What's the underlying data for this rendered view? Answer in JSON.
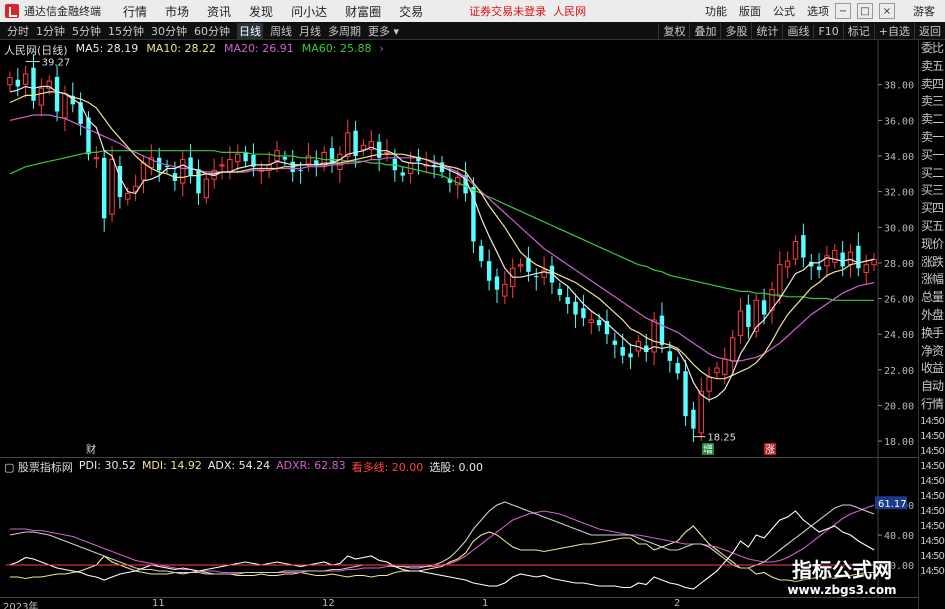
{
  "titlebar": {
    "app_name": "通达信金融终端",
    "menu": [
      "行情",
      "市场",
      "资讯",
      "发现",
      "问小达",
      "财富圈",
      "交易"
    ],
    "notice": "证券交易未登录",
    "stock_name": "人民网",
    "right_menu": [
      "功能",
      "版面",
      "公式",
      "选项"
    ],
    "guest": "游客",
    "window_controls": [
      "−",
      "□",
      "×"
    ]
  },
  "toolbar": {
    "periods": [
      "分时",
      "1分钟",
      "5分钟",
      "15分钟",
      "30分钟",
      "60分钟",
      "日线",
      "周线",
      "月线",
      "多周期",
      "更多"
    ],
    "active_period": "日线",
    "tools": [
      "复权",
      "叠加",
      "多股",
      "统计",
      "画线",
      "F10",
      "标记",
      "+自选",
      "返回"
    ]
  },
  "main_legend": {
    "title": "人民网(日线)",
    "ma5": "MA5: 28.19",
    "ma10": "MA10: 28.22",
    "ma20": "MA20: 26.91",
    "ma60": "MA60: 25.88"
  },
  "annotations": {
    "high": "39.27",
    "low": "18.25",
    "marker_cai": "财",
    "marker_lian": "涨",
    "marker_xian": "增"
  },
  "indicator_legend": {
    "name": "股票指标网",
    "pdi": "PDI: 30.52",
    "mdi": "MDI: 14.92",
    "adx": "ADX: 54.24",
    "adxr": "ADXR: 62.83",
    "fast": "看多线: 20.00",
    "select": "选股: 0.00",
    "current_value": "61.17"
  },
  "sidepanel": [
    "委比",
    "卖五",
    "卖四",
    "卖三",
    "卖二",
    "卖一",
    "买一",
    "买二",
    "买三",
    "买四",
    "买五",
    "现价",
    "涨跌",
    "涨幅",
    "总量",
    "外盘",
    "换手",
    "净资",
    "收益",
    "自动",
    "行情",
    "14:50",
    "14:50",
    "14:50",
    "14:50",
    "14:50",
    "14:50",
    "14:50",
    "14:50",
    "14:50",
    "14:50",
    "14:50"
  ],
  "time_axis": [
    "2023年",
    "11",
    "12",
    "1",
    "2"
  ],
  "watermark": {
    "title": "指标公式网",
    "url": "www.zbgs3.com"
  },
  "colors": {
    "up": "#ff3c3c",
    "down": "#54ffff",
    "ma5": "#e8e8e8",
    "ma10": "#f0e68c",
    "ma20": "#d060d0",
    "ma60": "#3cc83c"
  },
  "chart_data": {
    "type": "line",
    "ylim": [
      17.5,
      39.5
    ],
    "y_ticks": [
      "38.00",
      "36.00",
      "34.00",
      "32.00",
      "30.00",
      "28.00",
      "26.00",
      "24.00",
      "22.00",
      "20.00",
      "18.00"
    ],
    "close": [
      38.4,
      37.9,
      38.6,
      37.1,
      37.8,
      38.2,
      36.5,
      37.5,
      36.9,
      35.8,
      34.1,
      33.9,
      30.5,
      33.8,
      31.7,
      31.9,
      32.3,
      33.6,
      33.9,
      33.2,
      33.4,
      32.6,
      33.8,
      32.9,
      31.9,
      32.7,
      33.2,
      33.5,
      33.8,
      34.1,
      33.7,
      33.4,
      33.2,
      33.5,
      34.3,
      33.8,
      33.1,
      33.2,
      34.0,
      33.5,
      34.2,
      33.6,
      34.1,
      35.3,
      34.0,
      34.6,
      34.8,
      33.9,
      34.2,
      33.2,
      32.9,
      33.6,
      33.7,
      33.5,
      33.4,
      33.1,
      32.5,
      32.8,
      31.9,
      29.2,
      28.1,
      27.0,
      26.5,
      26.8,
      27.7,
      27.9,
      27.5,
      27.2,
      27.6,
      26.9,
      26.2,
      25.7,
      25.1,
      24.9,
      24.8,
      24.5,
      24.0,
      23.4,
      22.8,
      22.7,
      23.6,
      23.0,
      24.8,
      23.4,
      22.5,
      21.8,
      19.4,
      18.7,
      20.8,
      21.6,
      22.1,
      22.6,
      23.8,
      25.3,
      24.4,
      25.9,
      25.1,
      26.5,
      27.9,
      28.1,
      29.2,
      28.3,
      27.8,
      27.6,
      28.4,
      28.7,
      27.8,
      28.6,
      27.7,
      27.9,
      28.2
    ],
    "ma5": [
      37.6,
      37.7,
      37.9,
      37.8,
      37.9,
      37.9,
      37.6,
      37.5,
      37.2,
      36.9,
      36.0,
      35.6,
      34.3,
      34.0,
      32.8,
      32.0,
      31.9,
      32.6,
      32.7,
      32.9,
      33.3,
      33.3,
      33.5,
      33.3,
      33.2,
      33.0,
      32.9,
      33.1,
      33.1,
      33.3,
      33.4,
      33.5,
      33.5,
      33.5,
      33.7,
      33.6,
      33.5,
      33.5,
      33.5,
      33.5,
      33.6,
      33.6,
      33.8,
      34.1,
      34.2,
      34.3,
      34.5,
      34.3,
      34.3,
      34.1,
      33.7,
      33.6,
      33.6,
      33.5,
      33.4,
      33.4,
      33.2,
      33.0,
      32.7,
      31.7,
      30.5,
      29.5,
      28.6,
      27.7,
      27.2,
      27.2,
      27.3,
      27.4,
      27.5,
      27.4,
      27.0,
      26.7,
      26.2,
      25.7,
      25.3,
      25.0,
      24.6,
      24.2,
      23.8,
      23.4,
      23.3,
      23.1,
      23.3,
      23.2,
      23.3,
      23.1,
      22.4,
      21.3,
      20.6,
      20.3,
      20.5,
      20.9,
      21.8,
      22.9,
      23.6,
      24.4,
      24.8,
      25.4,
      26.0,
      26.7,
      27.4,
      27.6,
      28.0,
      28.0,
      28.3,
      28.2,
      28.1,
      28.2,
      28.0,
      28.1,
      28.2
    ],
    "ma10": [
      37.0,
      37.2,
      37.4,
      37.4,
      37.5,
      37.6,
      37.6,
      37.5,
      37.3,
      37.2,
      37.0,
      36.7,
      36.1,
      35.5,
      35.0,
      34.5,
      34.0,
      33.6,
      33.3,
      33.1,
      33.0,
      32.8,
      32.8,
      32.9,
      32.9,
      33.0,
      33.0,
      33.1,
      33.1,
      33.1,
      33.2,
      33.3,
      33.3,
      33.3,
      33.3,
      33.4,
      33.4,
      33.5,
      33.5,
      33.5,
      33.5,
      33.6,
      33.6,
      33.7,
      33.8,
      33.9,
      34.0,
      34.1,
      34.1,
      34.1,
      34.1,
      34.0,
      33.9,
      33.8,
      33.6,
      33.5,
      33.4,
      33.3,
      33.1,
      32.5,
      31.9,
      31.2,
      30.6,
      30.0,
      29.3,
      28.6,
      28.2,
      27.9,
      27.7,
      27.5,
      27.3,
      27.1,
      26.9,
      26.6,
      26.3,
      26.0,
      25.6,
      25.2,
      24.8,
      24.3,
      24.1,
      23.8,
      23.6,
      23.5,
      23.4,
      23.2,
      22.8,
      22.3,
      21.9,
      21.6,
      21.5,
      21.5,
      21.7,
      21.9,
      22.1,
      22.4,
      22.9,
      23.6,
      24.4,
      25.1,
      25.6,
      26.1,
      26.6,
      26.9,
      27.3,
      27.5,
      27.6,
      27.9,
      28.0,
      28.1,
      28.2
    ],
    "ma20": [
      36.0,
      36.1,
      36.2,
      36.3,
      36.3,
      36.3,
      36.2,
      36.1,
      35.9,
      35.7,
      35.5,
      35.3,
      35.1,
      34.9,
      34.7,
      34.4,
      34.2,
      34.0,
      33.8,
      33.6,
      33.5,
      33.4,
      33.3,
      33.3,
      33.2,
      33.1,
      33.1,
      33.1,
      33.1,
      33.1,
      33.1,
      33.2,
      33.2,
      33.2,
      33.3,
      33.3,
      33.3,
      33.3,
      33.4,
      33.4,
      33.4,
      33.5,
      33.5,
      33.6,
      33.6,
      33.7,
      33.8,
      33.8,
      33.9,
      33.9,
      33.9,
      33.9,
      33.9,
      33.8,
      33.7,
      33.5,
      33.3,
      33.1,
      32.8,
      32.4,
      32.0,
      31.6,
      31.2,
      30.8,
      30.4,
      30.0,
      29.6,
      29.2,
      28.8,
      28.5,
      28.2,
      27.9,
      27.6,
      27.3,
      27.0,
      26.7,
      26.4,
      26.1,
      25.8,
      25.5,
      25.2,
      24.9,
      24.7,
      24.5,
      24.3,
      24.1,
      23.8,
      23.5,
      23.2,
      22.9,
      22.7,
      22.6,
      22.5,
      22.5,
      22.6,
      22.7,
      22.9,
      23.2,
      23.5,
      23.9,
      24.3,
      24.7,
      25.1,
      25.4,
      25.7,
      26.0,
      26.3,
      26.5,
      26.7,
      26.8,
      26.9
    ],
    "ma60": [
      33.0,
      33.2,
      33.4,
      33.5,
      33.6,
      33.7,
      33.8,
      33.9,
      34.0,
      34.1,
      34.2,
      34.2,
      34.3,
      34.3,
      34.3,
      34.3,
      34.3,
      34.3,
      34.3,
      34.3,
      34.3,
      34.3,
      34.3,
      34.3,
      34.3,
      34.3,
      34.3,
      34.2,
      34.2,
      34.2,
      34.2,
      34.1,
      34.1,
      34.1,
      34.0,
      34.0,
      34.0,
      33.9,
      33.9,
      33.9,
      33.8,
      33.8,
      33.8,
      33.7,
      33.7,
      33.7,
      33.6,
      33.6,
      33.5,
      33.5,
      33.4,
      33.3,
      33.2,
      33.1,
      33.0,
      32.9,
      32.7,
      32.5,
      32.3,
      32.1,
      31.9,
      31.7,
      31.5,
      31.3,
      31.1,
      30.9,
      30.7,
      30.5,
      30.3,
      30.1,
      29.9,
      29.7,
      29.5,
      29.3,
      29.1,
      28.9,
      28.7,
      28.5,
      28.3,
      28.1,
      27.9,
      27.8,
      27.6,
      27.5,
      27.3,
      27.2,
      27.1,
      27.0,
      26.9,
      26.8,
      26.7,
      26.6,
      26.5,
      26.4,
      26.4,
      26.3,
      26.3,
      26.2,
      26.2,
      26.1,
      26.1,
      26.1,
      26.0,
      26.0,
      26.0,
      25.9,
      25.9,
      25.9,
      25.9,
      25.9,
      25.9
    ]
  },
  "indicator_data": {
    "ylim": [
      0,
      80
    ],
    "y_ticks": [
      "60.00",
      "40.00",
      "20.00"
    ],
    "pdi": [
      20,
      22,
      25,
      24,
      22,
      20,
      18,
      17,
      16,
      15,
      13,
      12,
      10,
      12,
      14,
      15,
      16,
      18,
      20,
      19,
      18,
      17,
      18,
      17,
      16,
      17,
      18,
      19,
      20,
      21,
      22,
      21,
      20,
      21,
      22,
      21,
      20,
      19,
      20,
      21,
      22,
      20,
      21,
      26,
      24,
      25,
      26,
      23,
      22,
      19,
      17,
      16,
      16,
      15,
      14,
      13,
      12,
      11,
      10,
      8,
      7,
      6,
      6,
      8,
      12,
      14,
      13,
      12,
      13,
      11,
      10,
      9,
      8,
      8,
      7,
      6,
      6,
      6,
      5,
      5,
      8,
      7,
      12,
      10,
      8,
      7,
      5,
      4,
      8,
      12,
      16,
      22,
      28,
      36,
      32,
      40,
      38,
      44,
      50,
      52,
      56,
      50,
      46,
      42,
      44,
      46,
      42,
      40,
      36,
      33,
      30
    ],
    "mdi": [
      12,
      12,
      11,
      12,
      12,
      13,
      14,
      14,
      15,
      16,
      18,
      20,
      26,
      22,
      20,
      18,
      16,
      15,
      14,
      14,
      14,
      15,
      14,
      15,
      16,
      15,
      14,
      14,
      14,
      13,
      13,
      13,
      14,
      13,
      13,
      14,
      14,
      15,
      14,
      13,
      13,
      14,
      13,
      12,
      13,
      13,
      12,
      13,
      13,
      15,
      16,
      16,
      16,
      17,
      18,
      19,
      22,
      24,
      28,
      36,
      40,
      42,
      40,
      36,
      32,
      30,
      30,
      30,
      29,
      30,
      31,
      32,
      33,
      34,
      34,
      35,
      36,
      37,
      38,
      38,
      34,
      34,
      30,
      32,
      34,
      36,
      42,
      46,
      40,
      34,
      30,
      26,
      22,
      18,
      18,
      14,
      15,
      12,
      10,
      10,
      9,
      10,
      11,
      12,
      12,
      11,
      12,
      13,
      14,
      15,
      15
    ],
    "adx": [
      40,
      41,
      42,
      42,
      41,
      40,
      38,
      36,
      34,
      32,
      30,
      28,
      26,
      24,
      22,
      20,
      18,
      17,
      17,
      16,
      16,
      15,
      15,
      15,
      15,
      14,
      14,
      14,
      14,
      14,
      15,
      15,
      15,
      15,
      15,
      16,
      16,
      16,
      16,
      16,
      16,
      17,
      17,
      18,
      19,
      20,
      20,
      20,
      20,
      19,
      19,
      18,
      18,
      19,
      20,
      22,
      25,
      30,
      36,
      44,
      50,
      56,
      60,
      62,
      60,
      58,
      56,
      54,
      52,
      50,
      48,
      46,
      44,
      42,
      40,
      40,
      40,
      40,
      40,
      40,
      38,
      36,
      34,
      32,
      30,
      30,
      32,
      34,
      34,
      32,
      28,
      24,
      20,
      18,
      18,
      20,
      22,
      26,
      30,
      34,
      38,
      42,
      46,
      50,
      54,
      58,
      60,
      60,
      58,
      56,
      54
    ],
    "adxr": [
      44,
      44,
      44,
      43,
      43,
      42,
      41,
      40,
      39,
      37,
      35,
      33,
      31,
      29,
      27,
      25,
      23,
      22,
      21,
      20,
      19,
      18,
      17,
      17,
      16,
      16,
      16,
      15,
      15,
      15,
      15,
      15,
      15,
      15,
      15,
      15,
      15,
      15,
      16,
      16,
      16,
      16,
      16,
      17,
      17,
      18,
      18,
      18,
      19,
      19,
      19,
      19,
      19,
      19,
      19,
      20,
      21,
      23,
      26,
      30,
      34,
      38,
      42,
      46,
      50,
      52,
      54,
      55,
      56,
      55,
      54,
      52,
      50,
      48,
      46,
      44,
      43,
      42,
      41,
      40,
      40,
      39,
      38,
      37,
      36,
      35,
      34,
      34,
      34,
      33,
      32,
      30,
      28,
      26,
      24,
      23,
      22,
      22,
      23,
      25,
      28,
      31,
      35,
      39,
      43,
      47,
      51,
      54,
      56,
      58,
      60
    ]
  }
}
